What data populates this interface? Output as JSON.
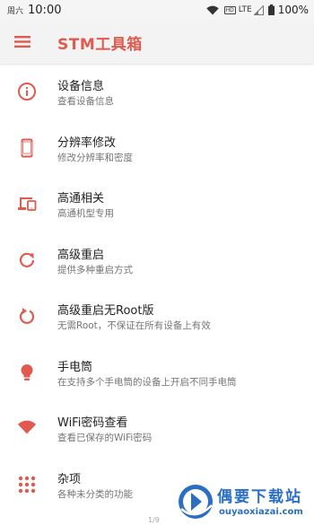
{
  "status_bar": {
    "weekday": "周六",
    "time": "10:00",
    "hd": "HD",
    "network": "LTE",
    "battery": "100%"
  },
  "app_bar": {
    "title": "STM工具箱",
    "menu_icon": "menu-icon"
  },
  "colors": {
    "accent": "#e05a4f",
    "title_text": "#222222",
    "subtitle_text": "#757575",
    "app_bar_bg": "#f3f3f3"
  },
  "items": [
    {
      "title": "设备信息",
      "subtitle": "查看设备信息",
      "icon": "info-icon"
    },
    {
      "title": "分辨率修改",
      "subtitle": "修改分辨率和密度",
      "icon": "phone-icon"
    },
    {
      "title": "高通相关",
      "subtitle": "高通机型专用",
      "icon": "devices-icon"
    },
    {
      "title": "高级重启",
      "subtitle": "提供多种重启方式",
      "icon": "refresh-icon"
    },
    {
      "title": "高级重启无Root版",
      "subtitle": "无需Root，不保证在所有设备上有效",
      "icon": "restart-icon"
    },
    {
      "title": "手电筒",
      "subtitle": "在支持多个手电筒的设备上开启不同手电筒",
      "icon": "lightbulb-icon"
    },
    {
      "title": "WiFi密码查看",
      "subtitle": "查看已保存的WiFi密码",
      "icon": "wifi-icon"
    },
    {
      "title": "杂项",
      "subtitle": "各种未分类的功能",
      "icon": "apps-grid-icon"
    }
  ],
  "page_indicator": "1/9",
  "watermark": {
    "name": "偶要下载站",
    "url": "ouyaoxiazai.com"
  }
}
